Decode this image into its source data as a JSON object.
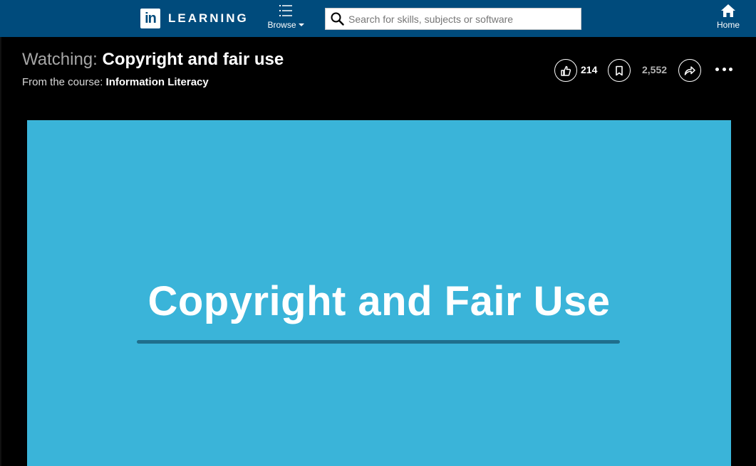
{
  "header": {
    "logo_mark": "in",
    "logo_text": "LEARNING",
    "browse_label": "Browse",
    "search_placeholder": "Search for skills, subjects or software",
    "search_value": "",
    "home_label": "Home",
    "icons": [
      "linkedin-logo",
      "browse-grid-icon",
      "search-icon",
      "home-icon"
    ],
    "bar_color": "#004b7c"
  },
  "video_header": {
    "prefix": "Watching:",
    "title": "Copyright and fair use",
    "course_prefix": "From the course:",
    "course_name": "Information Literacy"
  },
  "actions": {
    "like_count": "214",
    "save_count": "2,552",
    "icons": [
      "thumbs-up-icon",
      "bookmark-icon",
      "share-icon",
      "more-icon"
    ]
  },
  "player": {
    "slide_title": "Copyright and Fair Use",
    "background_color": "#3ab4d9",
    "rule_color": "#1f6e8c"
  }
}
